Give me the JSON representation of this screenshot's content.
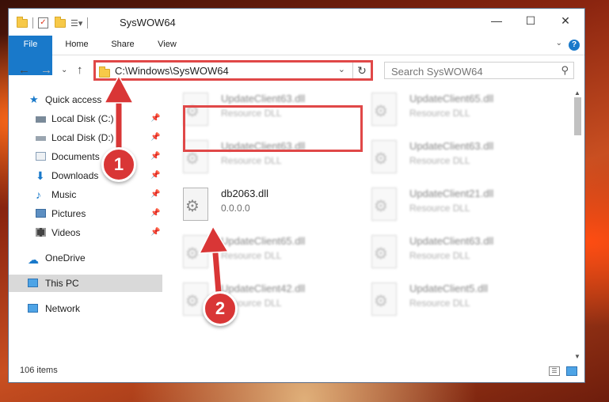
{
  "window": {
    "title": "SysWOW64",
    "controls": {
      "minimize": "—",
      "maximize": "☐",
      "close": "✕"
    }
  },
  "ribbon": {
    "tabs": [
      "File",
      "Home",
      "Share",
      "View"
    ],
    "help": "?"
  },
  "address": {
    "path": "C:\\Windows\\SysWOW64",
    "search_placeholder": "Search SysWOW64"
  },
  "sidebar": {
    "items": [
      {
        "label": "Quick access",
        "icon": "star-icon",
        "pinned": false
      },
      {
        "label": "Local Disk (C:)",
        "icon": "drive-icon",
        "pinned": true
      },
      {
        "label": "Local Disk (D:)",
        "icon": "drive-icon",
        "pinned": true
      },
      {
        "label": "Documents",
        "icon": "documents-icon",
        "pinned": true
      },
      {
        "label": "Downloads",
        "icon": "download-icon",
        "pinned": true
      },
      {
        "label": "Music",
        "icon": "music-icon",
        "pinned": true
      },
      {
        "label": "Pictures",
        "icon": "pictures-icon",
        "pinned": true
      },
      {
        "label": "Videos",
        "icon": "videos-icon",
        "pinned": true
      },
      {
        "label": "OneDrive",
        "icon": "cloud-icon",
        "pinned": false
      },
      {
        "label": "This PC",
        "icon": "computer-icon",
        "pinned": false,
        "selected": true
      },
      {
        "label": "Network",
        "icon": "network-icon",
        "pinned": false
      }
    ]
  },
  "files": [
    {
      "name": "UpdateClient63.dll",
      "type": "Resource DLL",
      "blurred": true
    },
    {
      "name": "UpdateClient65.dll",
      "type": "Resource DLL",
      "blurred": true
    },
    {
      "name": "UpdateClient63.dll",
      "type": "Resource DLL",
      "blurred": true
    },
    {
      "name": "UpdateClient63.dll",
      "type": "Resource DLL",
      "blurred": true
    },
    {
      "name": "db2063.dll",
      "type": "0.0.0.0",
      "blurred": false,
      "highlighted": true
    },
    {
      "name": "UpdateClient21.dll",
      "type": "Resource DLL",
      "blurred": true
    },
    {
      "name": "UpdateClient65.dll",
      "type": "Resource DLL",
      "blurred": true
    },
    {
      "name": "UpdateClient63.dll",
      "type": "Resource DLL",
      "blurred": true
    },
    {
      "name": "UpdateClient42.dll",
      "type": "Resource DLL",
      "blurred": true
    },
    {
      "name": "UpdateClient5.dll",
      "type": "Resource DLL",
      "blurred": true
    }
  ],
  "status": {
    "count": "106 items"
  },
  "annotations": {
    "step1": "1",
    "step2": "2",
    "color": "#d93636"
  }
}
